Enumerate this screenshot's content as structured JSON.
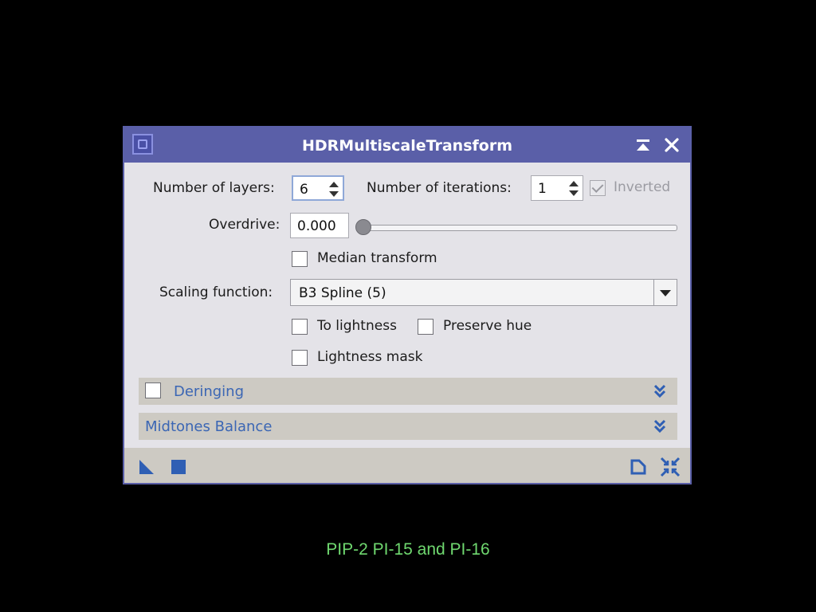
{
  "window": {
    "title": "HDRMultiscaleTransform"
  },
  "layers": {
    "label": "Number of layers:",
    "value": "6"
  },
  "iterations": {
    "label": "Number of iterations:",
    "value": "1"
  },
  "inverted": {
    "label": "Inverted",
    "checked": true,
    "enabled": false
  },
  "overdrive": {
    "label": "Overdrive:",
    "value": "0.000",
    "slider_fraction": 0.0
  },
  "median_transform": {
    "label": "Median transform",
    "checked": false
  },
  "scaling": {
    "label": "Scaling function:",
    "value": "B3 Spline (5)"
  },
  "to_lightness": {
    "label": "To lightness",
    "checked": false
  },
  "preserve_hue": {
    "label": "Preserve hue",
    "checked": false
  },
  "lightness_mask": {
    "label": "Lightness mask",
    "checked": false
  },
  "sections": {
    "deringing": {
      "label": "Deringing",
      "checked": false
    },
    "midtones": {
      "label": "Midtones Balance"
    }
  },
  "colors": {
    "titlebar": "#5a5fa8",
    "section_text": "#3b66b4",
    "caption": "#6fd86f"
  },
  "caption": "PIP-2 PI-15 and PI-16"
}
